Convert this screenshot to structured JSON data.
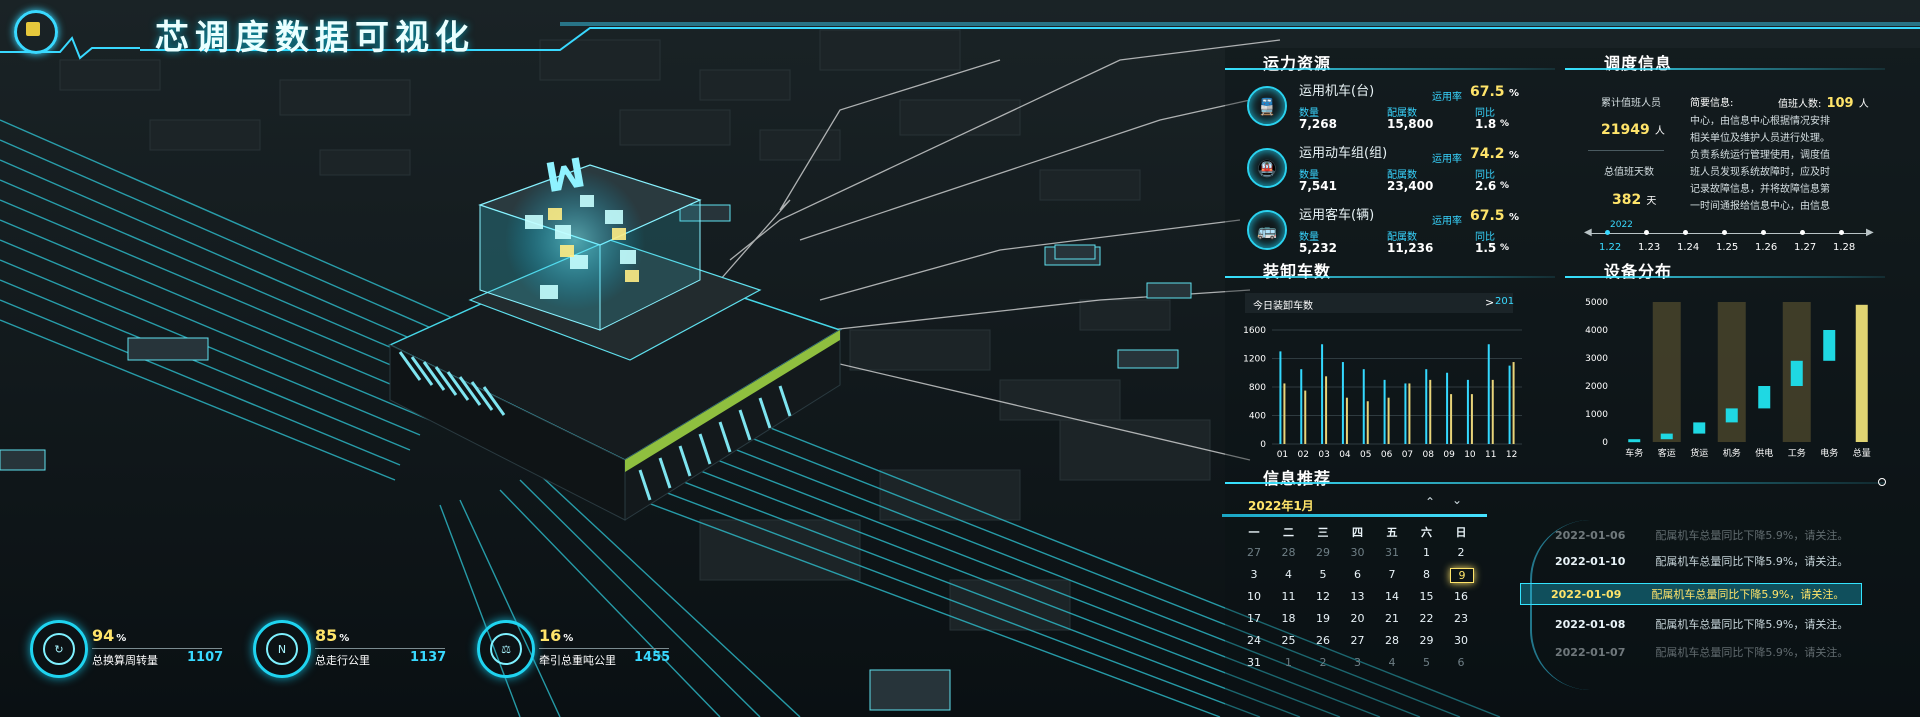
{
  "page": {
    "title": "芯调度数据可视化"
  },
  "transport": {
    "title": "运力资源",
    "rows": [
      {
        "name": "运用机车(台)",
        "rate_label": "运用率",
        "rate": "67.5",
        "rate_unit": "%",
        "count_label": "数量",
        "count": "7,268",
        "alloc_label": "配属数",
        "alloc": "15,800",
        "yoy_label": "同比",
        "yoy": "1.8",
        "yoy_unit": "%",
        "icon": "train-icon"
      },
      {
        "name": "运用动车组(组)",
        "rate_label": "运用率",
        "rate": "74.2",
        "rate_unit": "%",
        "count_label": "数量",
        "count": "7,541",
        "alloc_label": "配属数",
        "alloc": "23,400",
        "yoy_label": "同比",
        "yoy": "2.6",
        "yoy_unit": "%",
        "icon": "emu-icon"
      },
      {
        "name": "运用客车(辆)",
        "rate_label": "运用率",
        "rate": "67.5",
        "rate_unit": "%",
        "count_label": "数量",
        "count": "5,232",
        "alloc_label": "配属数",
        "alloc": "11,236",
        "yoy_label": "同比",
        "yoy": "1.5",
        "yoy_unit": "%",
        "icon": "bus-icon"
      }
    ]
  },
  "dispatch": {
    "title": "调度信息",
    "cumulative_label": "累计值班人员",
    "cumulative_value": "21949",
    "cumulative_unit": "人",
    "days_label": "总值班天数",
    "days_value": "382",
    "days_unit": "天",
    "brief_label": "简要信息:",
    "duty_label": "值班人数:",
    "duty_value": "109",
    "duty_unit": "人",
    "brief_text": "中心，由信息中心根据情况安排相关单位及维护人员进行处理。负责系统运行管理使用，调度值班人员发现系统故障时，应及时记录故障信息，并将故障信息第一时间通报给信息中心，由信息中心根据情况安排相关单",
    "timeline_year": "2022",
    "timeline": [
      "1.22",
      "1.23",
      "1.24",
      "1.25",
      "1.26",
      "1.27",
      "1.28"
    ]
  },
  "loading": {
    "title": "装卸车数",
    "today_label": "今日装卸车数",
    "today_value": "201",
    "today_arrow": ">"
  },
  "equipment": {
    "title": "设备分布"
  },
  "info": {
    "title": "信息推荐",
    "month_label": "2022年1月",
    "weekdays": [
      "一",
      "二",
      "三",
      "四",
      "五",
      "六",
      "日"
    ],
    "weeks": [
      [
        "27",
        "28",
        "29",
        "30",
        "31",
        "1",
        "2"
      ],
      [
        "3",
        "4",
        "5",
        "6",
        "7",
        "8",
        "9"
      ],
      [
        "10",
        "11",
        "12",
        "13",
        "14",
        "15",
        "16"
      ],
      [
        "17",
        "18",
        "19",
        "20",
        "21",
        "22",
        "23"
      ],
      [
        "24",
        "25",
        "26",
        "27",
        "28",
        "29",
        "30"
      ],
      [
        "31",
        "1",
        "2",
        "3",
        "4",
        "5",
        "6"
      ]
    ],
    "news": [
      {
        "date": "2022-01-06",
        "text": "配属机车总量同比下降5.9%，请关注。"
      },
      {
        "date": "2022-01-10",
        "text": "配属机车总量同比下降5.9%，请关注。"
      },
      {
        "date": "2022-01-09",
        "text": "配属机车总量同比下降5.9%，请关注。"
      },
      {
        "date": "2022-01-08",
        "text": "配属机车总量同比下降5.9%，请关注。"
      },
      {
        "date": "2022-01-07",
        "text": "配属机车总量同比下降5.9%，请关注。"
      }
    ]
  },
  "stats": [
    {
      "pct": "94",
      "unit": "%",
      "label": "总换算周转量",
      "value": "1107",
      "icon": "cycle-icon"
    },
    {
      "pct": "85",
      "unit": "%",
      "label": "总走行公里",
      "value": "1137",
      "icon": "compass-icon"
    },
    {
      "pct": "16",
      "unit": "%",
      "label": "牵引总重吨公里",
      "value": "1455",
      "icon": "weight-icon"
    }
  ],
  "chip": {
    "logo_text": "M"
  },
  "chart_data": [
    {
      "type": "bar",
      "title": "装卸车数",
      "categories": [
        "01",
        "02",
        "03",
        "04",
        "05",
        "06",
        "07",
        "08",
        "09",
        "10",
        "11",
        "12"
      ],
      "series": [
        {
          "values": [
            1300,
            1050,
            1400,
            1150,
            1050,
            900,
            850,
            1050,
            1000,
            900,
            1400,
            1100
          ]
        },
        {
          "values": [
            850,
            750,
            950,
            650,
            600,
            650,
            850,
            900,
            700,
            700,
            900,
            1150
          ]
        }
      ],
      "ylim": [
        0,
        1600
      ],
      "yticks": [
        0,
        400,
        800,
        1200,
        1600
      ],
      "colors": [
        "#33d9ff",
        "#e8d47a"
      ]
    },
    {
      "type": "bar",
      "title": "设备分布",
      "categories": [
        "车务",
        "客运",
        "货运",
        "机务",
        "供电",
        "工务",
        "电务",
        "总量"
      ],
      "values": [
        100,
        300,
        700,
        1200,
        2000,
        2900,
        4000,
        4900
      ],
      "ylim": [
        0,
        5000
      ],
      "yticks": [
        0,
        1000,
        2000,
        3000,
        4000,
        5000
      ],
      "colors": [
        "#1fd8e3",
        "#e0d472"
      ]
    }
  ]
}
